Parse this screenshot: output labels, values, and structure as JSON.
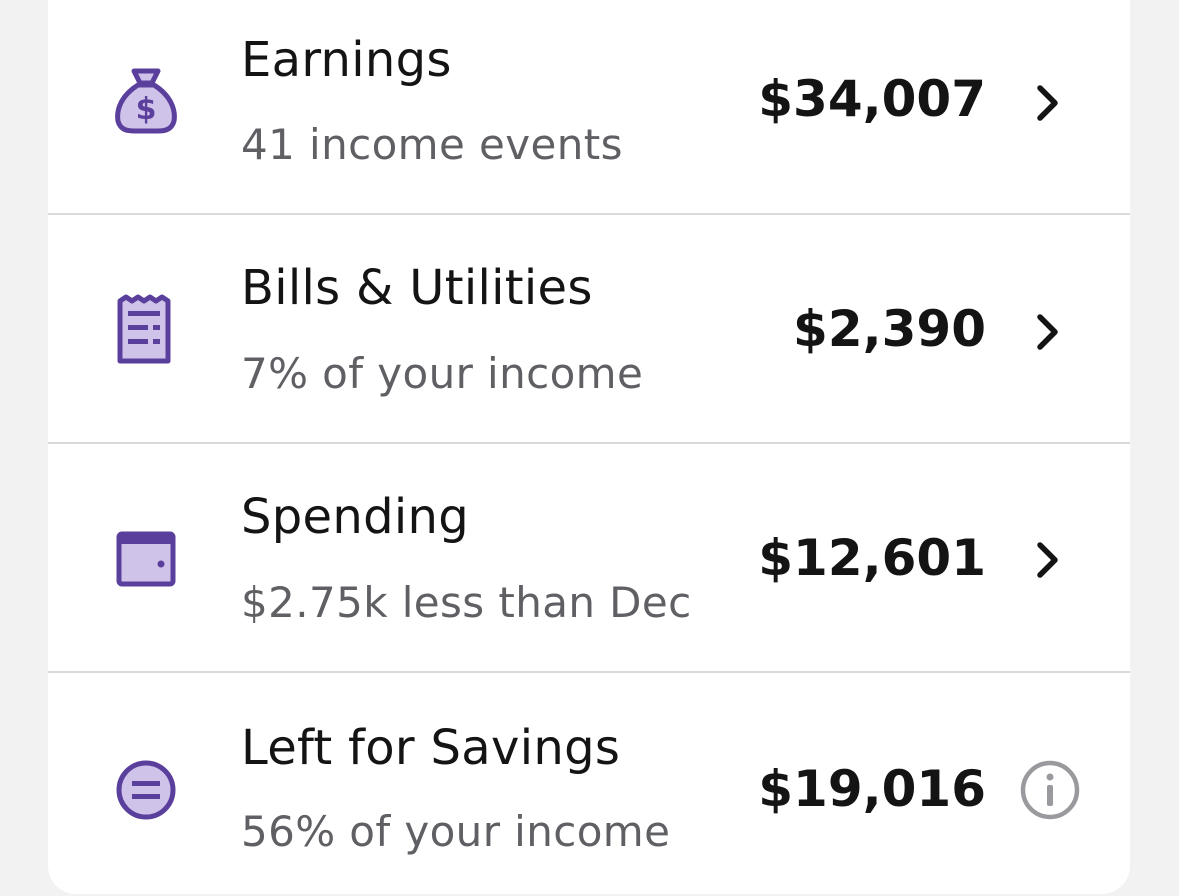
{
  "colors": {
    "accent": "#5b3f9c",
    "accent_fill": "#cfc3ea",
    "title_text": "#141414",
    "subtitle_text": "#5f5f64",
    "divider": "#d9d9dc",
    "info_icon": "#9a9a9e"
  },
  "rows": [
    {
      "icon": "money-bag-icon",
      "title": "Earnings",
      "subtitle": "41 income events",
      "amount": "$34,007",
      "trailing_icon": "chevron-right-icon"
    },
    {
      "icon": "receipt-icon",
      "title": "Bills & Utilities",
      "subtitle": "7% of your income",
      "amount": "$2,390",
      "trailing_icon": "chevron-right-icon"
    },
    {
      "icon": "wallet-icon",
      "title": "Spending",
      "subtitle": "$2.75k less than Dec",
      "amount": "$12,601",
      "trailing_icon": "chevron-right-icon"
    },
    {
      "icon": "savings-equal-icon",
      "title": "Left for Savings",
      "subtitle": "56% of your income",
      "amount": "$19,016",
      "trailing_icon": "info-icon"
    }
  ]
}
